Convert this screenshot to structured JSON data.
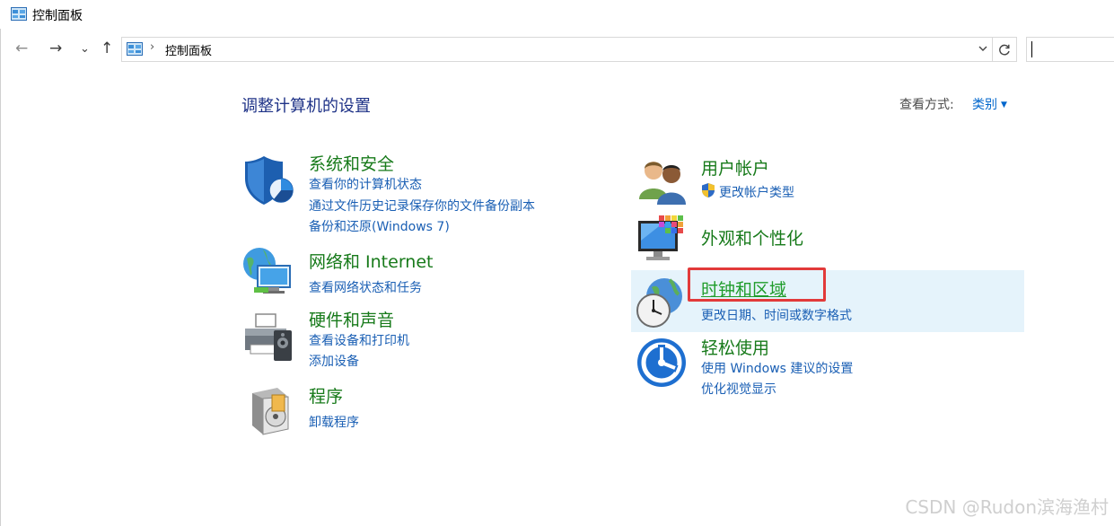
{
  "window": {
    "title": "控制面板"
  },
  "address": {
    "crumb": "控制面板",
    "separator": "›"
  },
  "nav": {
    "back": "←",
    "forward": "→",
    "recent": "⌄",
    "up": "↑"
  },
  "main": {
    "heading": "调整计算机的设置",
    "view_by_label": "查看方式:",
    "view_by_value": "类别"
  },
  "categories": {
    "system": {
      "title": "系统和安全",
      "links": [
        "查看你的计算机状态",
        "通过文件历史记录保存你的文件备份副本",
        "备份和还原(Windows 7)"
      ]
    },
    "network": {
      "title": "网络和 Internet",
      "links": [
        "查看网络状态和任务"
      ]
    },
    "hardware": {
      "title": "硬件和声音",
      "links": [
        "查看设备和打印机",
        "添加设备"
      ]
    },
    "programs": {
      "title": "程序",
      "links": [
        "卸载程序"
      ]
    },
    "users": {
      "title": "用户帐户",
      "links": [
        "更改帐户类型"
      ]
    },
    "appearance": {
      "title": "外观和个性化",
      "links": []
    },
    "clock": {
      "title": "时钟和区域",
      "links": [
        "更改日期、时间或数字格式"
      ]
    },
    "ease": {
      "title": "轻松使用",
      "links": [
        "使用 Windows 建议的设置",
        "优化视觉显示"
      ]
    }
  },
  "watermark": "CSDN @Rudon滨海渔村",
  "colors": {
    "heading": "#1e3287",
    "category": "#177a1a",
    "link": "#1a5fb4",
    "highlight": "#e5f3fb",
    "annotation": "#e23a3a"
  }
}
